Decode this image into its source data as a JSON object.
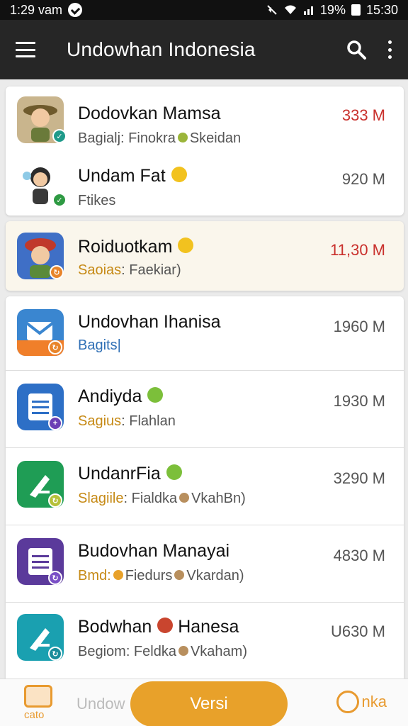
{
  "status_bar": {
    "time": "1:29 vam",
    "battery": "19%",
    "clock": "15:30"
  },
  "app_bar": {
    "title": "Undowhan Indonesia"
  },
  "list": [
    {
      "title": "Dodovkan Mamsa",
      "subtitle": "Bagialj: Finokra",
      "subtitle_extra": "Skeidan",
      "size": "333 M",
      "size_color": "#c9302c"
    },
    {
      "title": "Undam Fat",
      "subtitle": "Ftikes",
      "size": "920 M"
    },
    {
      "title": "Roiduotkam",
      "subtitle_label": "Saoias",
      "subtitle": ": Faekiar)",
      "size": "11,30 M",
      "size_color": "#c9302c"
    },
    {
      "title": "Undovhan Ihanisa",
      "subtitle": "Bagits|",
      "size": "1960 M"
    },
    {
      "title": "Andiyda",
      "subtitle_label": "Sagius",
      "subtitle": ": Flahlan",
      "size": "1930 M"
    },
    {
      "title": "UndanrFia",
      "subtitle_label": "Slagiile",
      "subtitle": ": Fialdka",
      "subtitle_extra": "VkahBn)",
      "size": "3290 M"
    },
    {
      "title": "Budovhan Manayai",
      "subtitle_label": "Bmd:",
      "subtitle": "Fiedurs",
      "subtitle_extra": "Vkardan)",
      "size": "4830 M"
    },
    {
      "title": "Bodwhan",
      "title_extra": "Hanesa",
      "subtitle": "Begiom: Feldka",
      "subtitle_extra": "Vkaham)",
      "size": "U630 M"
    }
  ],
  "bottom_bar": {
    "left_label": "cato",
    "ghost_text": "Undow",
    "primary_button": "Versi",
    "right_label": "nka"
  },
  "colors": {
    "accent": "#e8a12a",
    "appbar": "#262626",
    "red": "#c9302c"
  }
}
